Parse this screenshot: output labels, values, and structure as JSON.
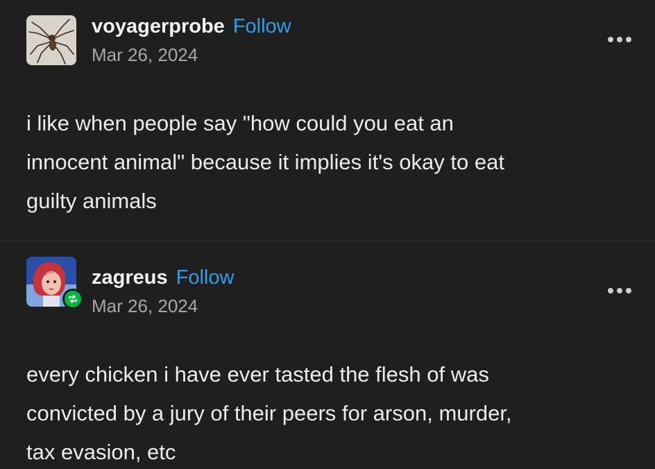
{
  "posts": [
    {
      "username": "voyagerprobe",
      "follow_label": "Follow",
      "date": "Mar 26, 2024",
      "avatar_icon": "spider-avatar-icon",
      "more_icon": "more-options-icon",
      "lines": [
        "i like when people say \"how could you eat an",
        "innocent animal\" because it implies it's okay to eat",
        "guilty animals"
      ]
    },
    {
      "username": "zagreus",
      "follow_label": "Follow",
      "date": "Mar 26, 2024",
      "avatar_icon": "character-avatar-icon",
      "badge_icon": "reblog-icon",
      "more_icon": "more-options-icon",
      "lines": [
        "every chicken i have ever tasted the flesh of was",
        "convicted by a jury of their peers for arson, murder,",
        "tax evasion, etc"
      ]
    }
  ],
  "colors": {
    "background": "#1f1f1f",
    "follow": "#2f9ee5",
    "date": "#a8a8a8",
    "reblog_badge": "#00b83f"
  }
}
